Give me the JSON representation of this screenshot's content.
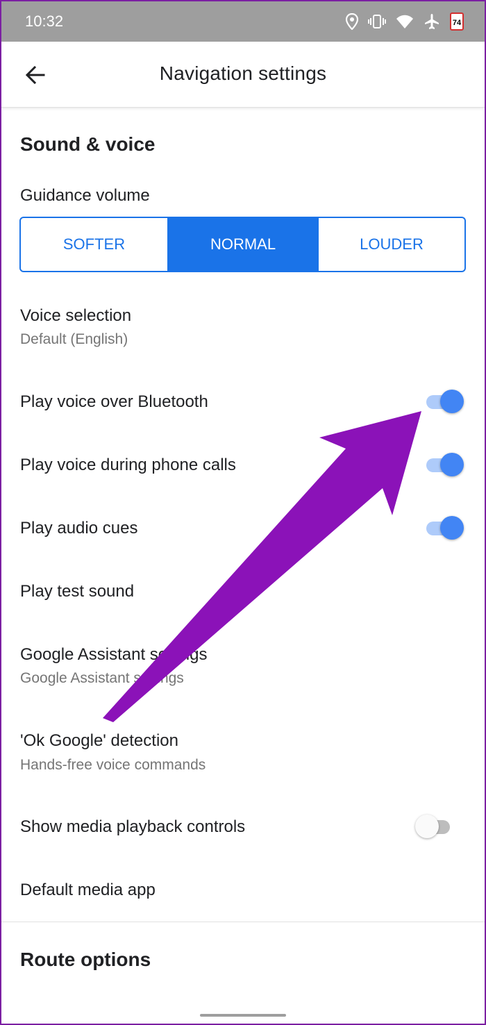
{
  "status_bar": {
    "time": "10:32",
    "battery": "74"
  },
  "header": {
    "title": "Navigation settings"
  },
  "sections": {
    "sound_voice": "Sound & voice",
    "route_options": "Route options"
  },
  "guidance_volume": {
    "label": "Guidance volume",
    "options": [
      "SOFTER",
      "NORMAL",
      "LOUDER"
    ],
    "selected": "NORMAL"
  },
  "settings": {
    "voice_selection": {
      "title": "Voice selection",
      "subtitle": "Default (English)"
    },
    "bluetooth": {
      "title": "Play voice over Bluetooth",
      "enabled": true
    },
    "phone_calls": {
      "title": "Play voice during phone calls",
      "enabled": true
    },
    "audio_cues": {
      "title": "Play audio cues",
      "enabled": true
    },
    "test_sound": {
      "title": "Play test sound"
    },
    "assistant": {
      "title": "Google Assistant settings",
      "subtitle": "Google Assistant settings"
    },
    "ok_google": {
      "title": "'Ok Google' detection",
      "subtitle": "Hands-free voice commands"
    },
    "media_controls": {
      "title": "Show media playback controls",
      "enabled": false
    },
    "media_app": {
      "title": "Default media app"
    }
  },
  "colors": {
    "accent": "#1a73e8",
    "toggle_on": "#4285f4",
    "annotation_arrow": "#8b12b8"
  }
}
